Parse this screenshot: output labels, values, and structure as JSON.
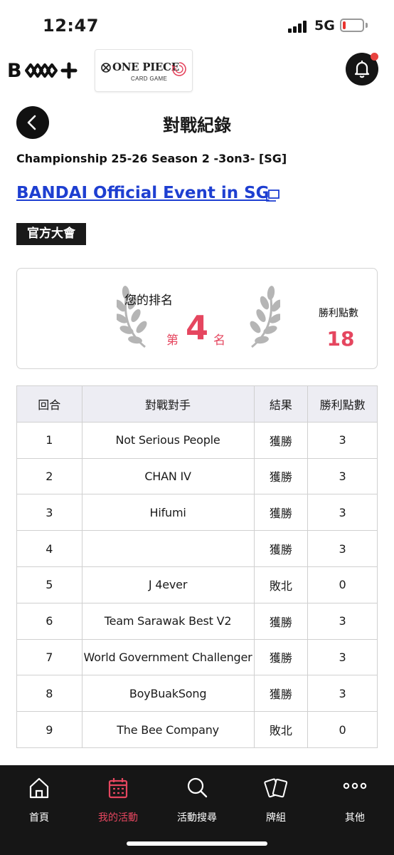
{
  "status_bar": {
    "time": "12:47",
    "network": "5G",
    "battery_level": 0.15,
    "battery_color": "#e8342f"
  },
  "header": {
    "brand_logo_letter": "B",
    "brand_logo_name": "Bandai Card Games Plus",
    "game_logo_title": "ONE PIECE",
    "game_logo_subtitle": "CARD GAME",
    "notification_icon": "bell-icon",
    "has_notification": true
  },
  "page": {
    "back_icon": "chevron-left-icon",
    "title": "對戰紀錄"
  },
  "event": {
    "subtitle": "Championship 25-26 Season 2 -3on3- [SG]",
    "name": "BANDAI Official Event in SG",
    "external_icon": "external-link-icon",
    "badge": "官方大會"
  },
  "ranking": {
    "caption": "您的排名",
    "prefix": "第",
    "rank": "4",
    "suffix": "名",
    "points_label": "勝利點數",
    "points": "18"
  },
  "results_table": {
    "headers": [
      "回合",
      "對戰對手",
      "結果",
      "勝利點數"
    ],
    "rows": [
      {
        "round": "1",
        "opponent": "Not Serious People",
        "result": "獲勝",
        "points": "3"
      },
      {
        "round": "2",
        "opponent": "CHAN IV",
        "result": "獲勝",
        "points": "3"
      },
      {
        "round": "3",
        "opponent": "Hifumi",
        "result": "獲勝",
        "points": "3"
      },
      {
        "round": "4",
        "opponent": "",
        "result": "獲勝",
        "points": "3"
      },
      {
        "round": "5",
        "opponent": "J 4ever",
        "result": "敗北",
        "points": "0"
      },
      {
        "round": "6",
        "opponent": "Team Sarawak Best V2",
        "result": "獲勝",
        "points": "3"
      },
      {
        "round": "7",
        "opponent": "World Government Challenger",
        "result": "獲勝",
        "points": "3"
      },
      {
        "round": "8",
        "opponent": "BoyBuakSong",
        "result": "獲勝",
        "points": "3"
      },
      {
        "round": "9",
        "opponent": "The Bee Company",
        "result": "敗北",
        "points": "0"
      }
    ]
  },
  "bottom_nav": {
    "items": [
      {
        "label": "首頁",
        "icon": "home-icon",
        "active": false
      },
      {
        "label": "我的活動",
        "icon": "calendar-icon",
        "active": true
      },
      {
        "label": "活動搜尋",
        "icon": "search-icon",
        "active": false
      },
      {
        "label": "牌組",
        "icon": "cards-icon",
        "active": false
      },
      {
        "label": "其他",
        "icon": "more-icon",
        "active": false
      }
    ]
  },
  "colors": {
    "accent": "#e5465f",
    "link": "#1e3fd1",
    "nav_background": "#161616",
    "table_header": "#ededf3"
  }
}
